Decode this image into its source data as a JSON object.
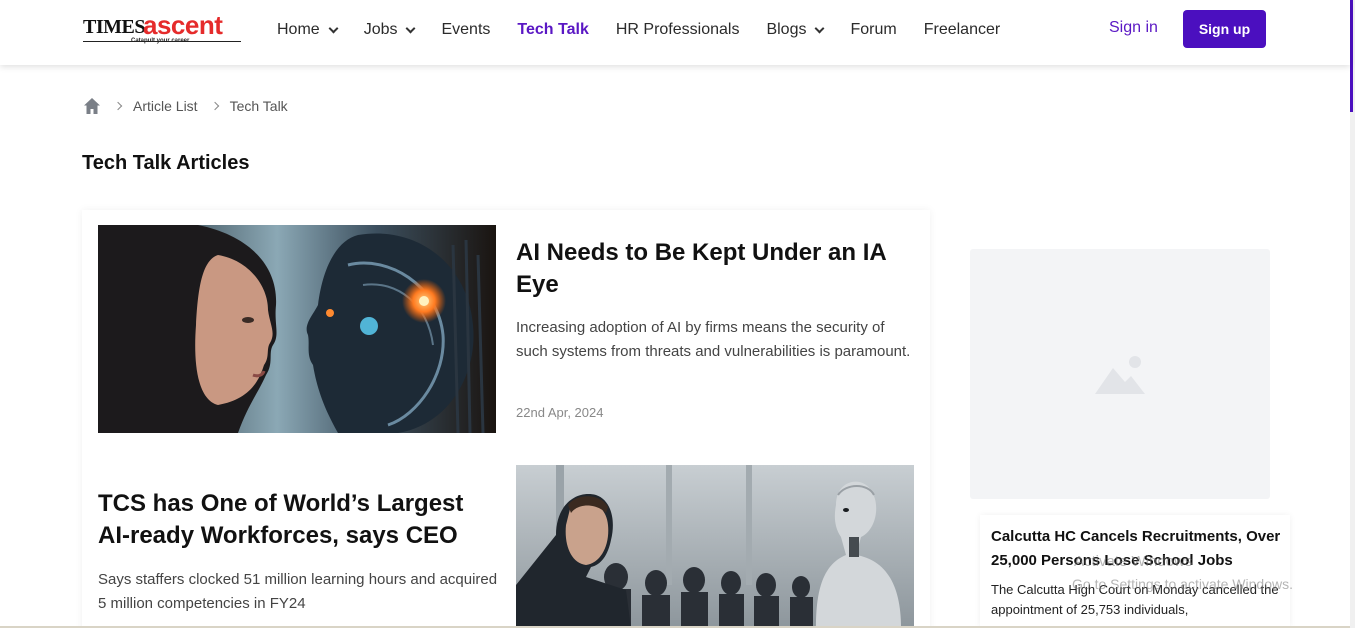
{
  "header": {
    "logo": {
      "times": "TIMES",
      "ascent": "ascent",
      "tagline": "Catapult your career"
    },
    "nav": [
      {
        "label": "Home",
        "dropdown": true,
        "active": false
      },
      {
        "label": "Jobs",
        "dropdown": true,
        "active": false
      },
      {
        "label": "Events",
        "dropdown": false,
        "active": false
      },
      {
        "label": "Tech Talk",
        "dropdown": false,
        "active": true
      },
      {
        "label": "HR Professionals",
        "dropdown": false,
        "active": false
      },
      {
        "label": "Blogs",
        "dropdown": true,
        "active": false
      },
      {
        "label": "Forum",
        "dropdown": false,
        "active": false
      },
      {
        "label": "Freelancer",
        "dropdown": false,
        "active": false
      }
    ],
    "signin": "Sign in",
    "signup": "Sign up"
  },
  "breadcrumb": {
    "items": [
      "Article List",
      "Tech Talk"
    ]
  },
  "page_title": "Tech Talk Articles",
  "articles": [
    {
      "title": "AI Needs to Be Kept Under an IA Eye",
      "description": "Increasing adoption of AI by firms means the security of such systems from threats and vulnerabilities is paramount.",
      "date": "22nd Apr, 2024"
    },
    {
      "title": "TCS has One of World’s Largest AI-ready Workforces, says CEO",
      "description": "Says staffers clocked 51 million learning hours and acquired 5 million competencies in FY24"
    }
  ],
  "sidebar": {
    "news": {
      "title": "Calcutta HC Cancels Recruitments, Over 25,000 Persons Lose School Jobs",
      "description": "The Calcutta High Court on Monday cancelled the appointment of 25,753 individuals,"
    }
  },
  "watermark": {
    "line1": "Activate Windows",
    "line2": "Go to Settings to activate Windows."
  },
  "colors": {
    "brand_purple": "#4b0fbf",
    "active_nav": "#5a17c4",
    "logo_red": "#e52b2b"
  }
}
